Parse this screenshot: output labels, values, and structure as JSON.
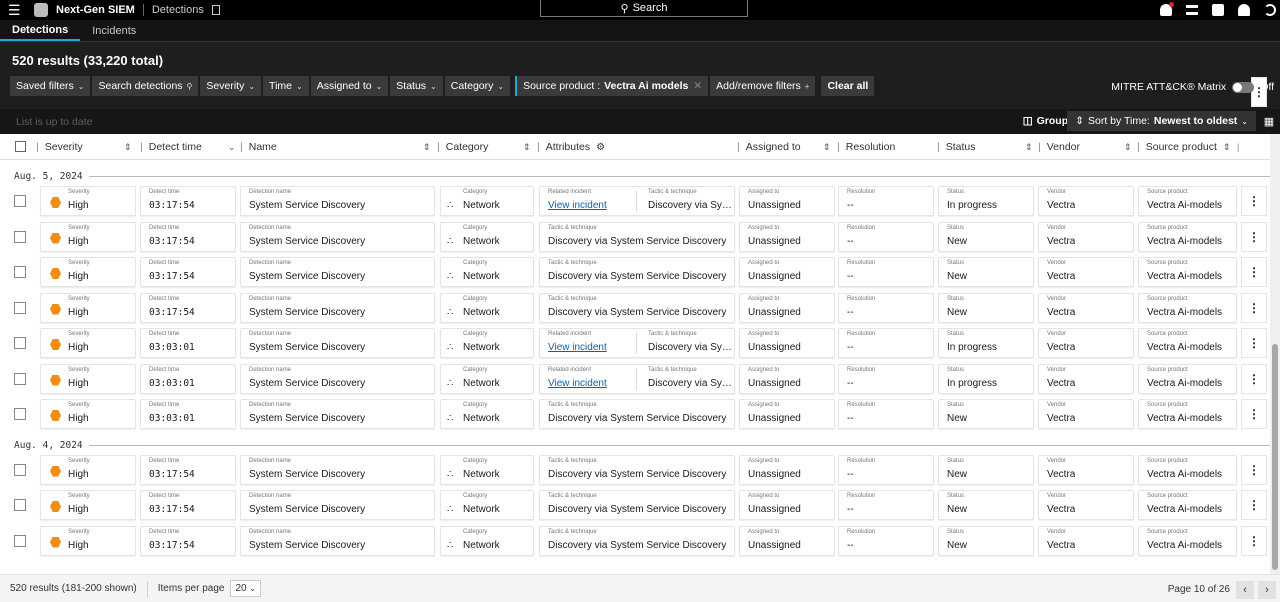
{
  "topbar": {
    "app_name": "Next-Gen SIEM",
    "breadcrumb": "Detections",
    "search_label": "Search"
  },
  "tabs": [
    {
      "label": "Detections",
      "active": true
    },
    {
      "label": "Incidents",
      "active": false
    }
  ],
  "results_title": "520 results (33,220 total)",
  "filters": {
    "saved_filters": "Saved filters",
    "search_detections": "Search detections",
    "severity": "Severity",
    "time": "Time",
    "assigned_to": "Assigned to",
    "status": "Status",
    "category": "Category",
    "source_product_label": "Source product :",
    "source_product_value": "Vectra Ai models",
    "add_remove": "Add/remove filters",
    "clear_all": "Clear all",
    "mitre_label": "MITRE ATT&CK® Matrix",
    "mitre_toggle": "Off"
  },
  "list_status": "List is up to date",
  "group_by": "Group by",
  "sort_label": "Sort by Time:",
  "sort_value": "Newest to oldest",
  "columns": {
    "severity": "Severity",
    "detect_time": "Detect time",
    "name": "Name",
    "category": "Category",
    "attributes": "Attributes",
    "assigned_to": "Assigned to",
    "resolution": "Resolution",
    "status": "Status",
    "vendor": "Vendor",
    "source_product": "Source product"
  },
  "field_labels": {
    "severity": "Severity",
    "detect_time": "Detect time",
    "detection_name": "Detection name",
    "category": "Category",
    "related_incident": "Related incident",
    "tactic": "Tactic & technique",
    "assigned_to": "Assigned to",
    "resolution": "Resolution",
    "status": "Status",
    "vendor": "Vendor",
    "source_product": "Source product"
  },
  "groups": [
    {
      "date": "Aug. 5, 2024",
      "rows": [
        {
          "severity": "High",
          "time": "03:17:54",
          "name": "System Service Discovery",
          "category": "Network",
          "incident": "View incident",
          "tactic": "Discovery via Syste...",
          "assigned": "Unassigned",
          "resolution": "--",
          "status": "In progress",
          "vendor": "Vectra",
          "product": "Vectra Ai-models"
        },
        {
          "severity": "High",
          "time": "03:17:54",
          "name": "System Service Discovery",
          "category": "Network",
          "incident": "",
          "tactic": "Discovery via System Service Discovery",
          "assigned": "Unassigned",
          "resolution": "--",
          "status": "New",
          "vendor": "Vectra",
          "product": "Vectra Ai-models"
        },
        {
          "severity": "High",
          "time": "03:17:54",
          "name": "System Service Discovery",
          "category": "Network",
          "incident": "",
          "tactic": "Discovery via System Service Discovery",
          "assigned": "Unassigned",
          "resolution": "--",
          "status": "New",
          "vendor": "Vectra",
          "product": "Vectra Ai-models"
        },
        {
          "severity": "High",
          "time": "03:17:54",
          "name": "System Service Discovery",
          "category": "Network",
          "incident": "",
          "tactic": "Discovery via System Service Discovery",
          "assigned": "Unassigned",
          "resolution": "--",
          "status": "New",
          "vendor": "Vectra",
          "product": "Vectra Ai-models"
        },
        {
          "severity": "High",
          "time": "03:03:01",
          "name": "System Service Discovery",
          "category": "Network",
          "incident": "View incident",
          "tactic": "Discovery via Syste...",
          "assigned": "Unassigned",
          "resolution": "--",
          "status": "In progress",
          "vendor": "Vectra",
          "product": "Vectra Ai-models"
        },
        {
          "severity": "High",
          "time": "03:03:01",
          "name": "System Service Discovery",
          "category": "Network",
          "incident": "View incident",
          "tactic": "Discovery via Syste...",
          "assigned": "Unassigned",
          "resolution": "--",
          "status": "In progress",
          "vendor": "Vectra",
          "product": "Vectra Ai-models"
        },
        {
          "severity": "High",
          "time": "03:03:01",
          "name": "System Service Discovery",
          "category": "Network",
          "incident": "",
          "tactic": "Discovery via System Service Discovery",
          "assigned": "Unassigned",
          "resolution": "--",
          "status": "New",
          "vendor": "Vectra",
          "product": "Vectra Ai-models"
        }
      ]
    },
    {
      "date": "Aug. 4, 2024",
      "rows": [
        {
          "severity": "High",
          "time": "03:17:54",
          "name": "System Service Discovery",
          "category": "Network",
          "incident": "",
          "tactic": "Discovery via System Service Discovery",
          "assigned": "Unassigned",
          "resolution": "--",
          "status": "New",
          "vendor": "Vectra",
          "product": "Vectra Ai-models"
        },
        {
          "severity": "High",
          "time": "03:17:54",
          "name": "System Service Discovery",
          "category": "Network",
          "incident": "",
          "tactic": "Discovery via System Service Discovery",
          "assigned": "Unassigned",
          "resolution": "--",
          "status": "New",
          "vendor": "Vectra",
          "product": "Vectra Ai-models"
        },
        {
          "severity": "High",
          "time": "03:17:54",
          "name": "System Service Discovery",
          "category": "Network",
          "incident": "",
          "tactic": "Discovery via System Service Discovery",
          "assigned": "Unassigned",
          "resolution": "--",
          "status": "New",
          "vendor": "Vectra",
          "product": "Vectra Ai-models"
        }
      ]
    }
  ],
  "footer": {
    "summary": "520 results (181-200 shown)",
    "items_per_page_label": "Items per page",
    "items_per_page": "20",
    "page": "Page 10 of 26"
  },
  "colors": {
    "accent": "#1ea9d8",
    "severity_high": "#f28c13",
    "link": "#0f62a8"
  }
}
